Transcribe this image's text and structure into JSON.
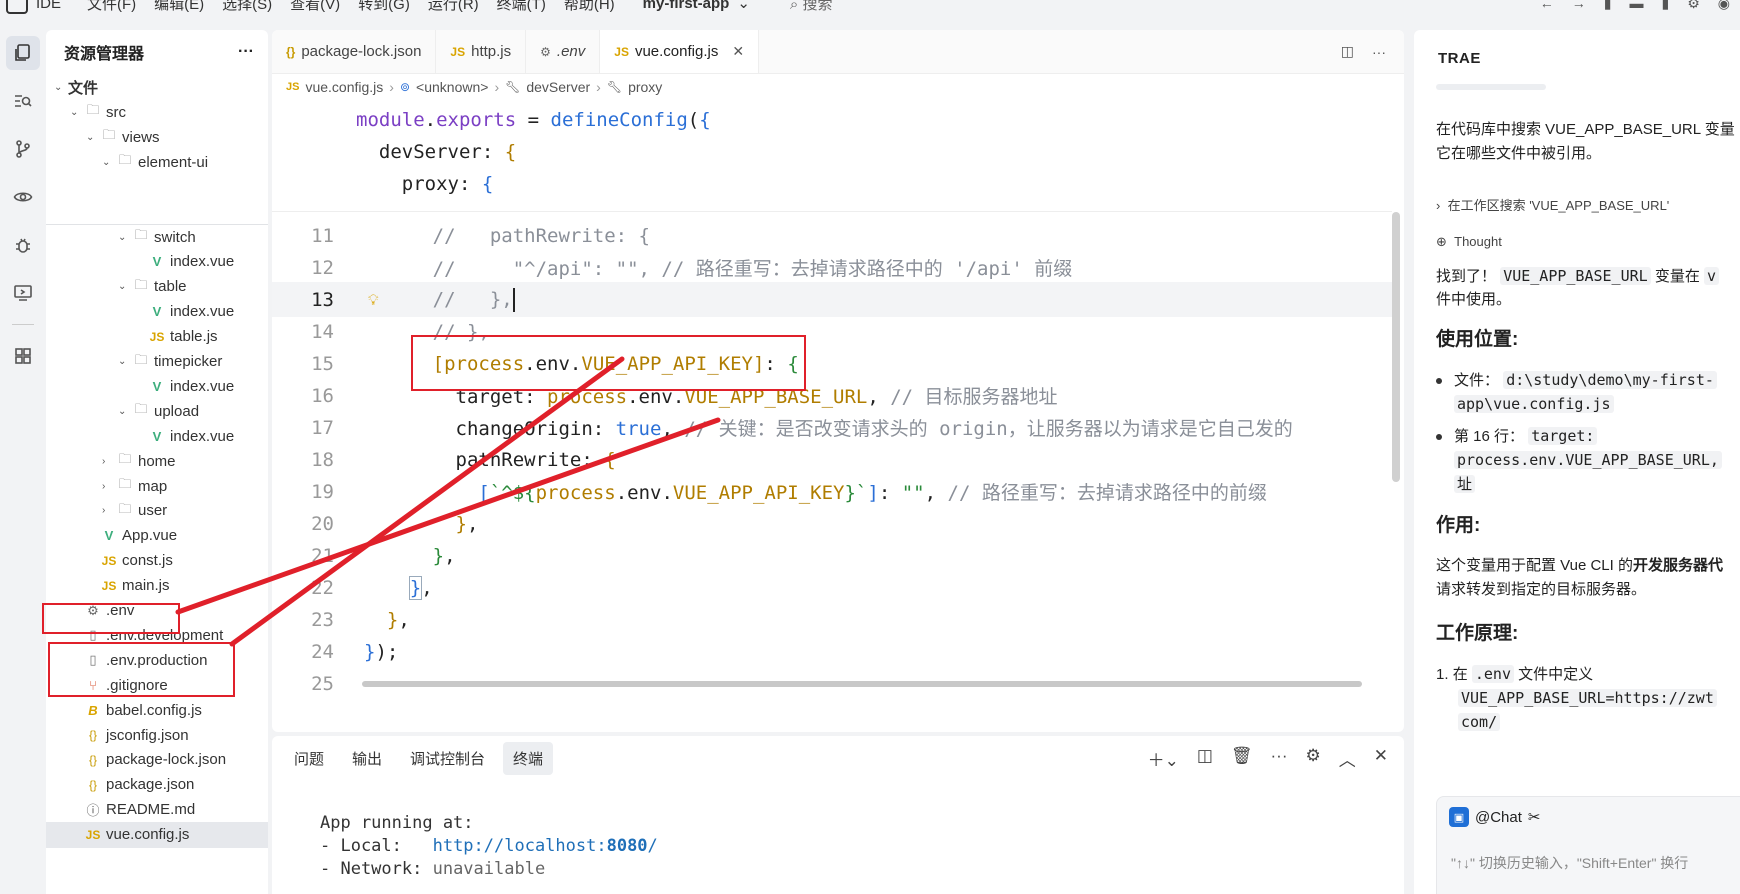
{
  "titlebar": {
    "app": "IDE",
    "menus": [
      "文件(F)",
      "编辑(E)",
      "选择(S)",
      "查看(V)",
      "转到(G)",
      "运行(R)",
      "终端(T)",
      "帮助(H)"
    ],
    "project": "my-first-app",
    "search": "搜索"
  },
  "explorer": {
    "title": "资源管理器",
    "more": "···",
    "items": [
      {
        "label": "文件",
        "depth": 0,
        "type": "root",
        "open": true
      },
      {
        "label": "src",
        "depth": 1,
        "type": "folder",
        "open": true
      },
      {
        "label": "views",
        "depth": 2,
        "type": "folder",
        "open": true
      },
      {
        "label": "element-ui",
        "depth": 3,
        "type": "folder",
        "open": true
      },
      {
        "label": "switch",
        "depth": 4,
        "type": "folder",
        "open": true
      },
      {
        "label": "index.vue",
        "depth": 5,
        "type": "vue"
      },
      {
        "label": "table",
        "depth": 4,
        "type": "folder",
        "open": true
      },
      {
        "label": "index.vue",
        "depth": 5,
        "type": "vue"
      },
      {
        "label": "table.js",
        "depth": 5,
        "type": "js"
      },
      {
        "label": "timepicker",
        "depth": 4,
        "type": "folder",
        "open": true
      },
      {
        "label": "index.vue",
        "depth": 5,
        "type": "vue"
      },
      {
        "label": "upload",
        "depth": 4,
        "type": "folder",
        "open": true
      },
      {
        "label": "index.vue",
        "depth": 5,
        "type": "vue"
      },
      {
        "label": "home",
        "depth": 3,
        "type": "folder",
        "open": false
      },
      {
        "label": "map",
        "depth": 3,
        "type": "folder",
        "open": false
      },
      {
        "label": "user",
        "depth": 3,
        "type": "folder",
        "open": false
      },
      {
        "label": "App.vue",
        "depth": 2,
        "type": "vue"
      },
      {
        "label": "const.js",
        "depth": 2,
        "type": "js"
      },
      {
        "label": "main.js",
        "depth": 2,
        "type": "js"
      },
      {
        "label": ".env",
        "depth": 1,
        "type": "gear"
      },
      {
        "label": ".env.development",
        "depth": 1,
        "type": "file"
      },
      {
        "label": ".env.production",
        "depth": 1,
        "type": "file"
      },
      {
        "label": ".gitignore",
        "depth": 1,
        "type": "git"
      },
      {
        "label": "babel.config.js",
        "depth": 1,
        "type": "babel"
      },
      {
        "label": "jsconfig.json",
        "depth": 1,
        "type": "json"
      },
      {
        "label": "package-lock.json",
        "depth": 1,
        "type": "json"
      },
      {
        "label": "package.json",
        "depth": 1,
        "type": "json"
      },
      {
        "label": "README.md",
        "depth": 1,
        "type": "info"
      },
      {
        "label": "vue.config.js",
        "depth": 1,
        "type": "js",
        "selected": true
      }
    ]
  },
  "editor": {
    "tabs": [
      {
        "label": "package-lock.json",
        "icon": "{}",
        "active": false
      },
      {
        "label": "http.js",
        "icon": "JS",
        "active": false
      },
      {
        "label": ".env",
        "icon": "⚙",
        "active": false,
        "italic": true
      },
      {
        "label": "vue.config.js",
        "icon": "JS",
        "active": true,
        "close": "✕"
      }
    ],
    "breadcrumb": [
      "vue.config.js",
      "<unknown>",
      "devServer",
      "proxy"
    ],
    "sticky": [
      "module.exports = defineConfig({",
      "  devServer: {",
      "    proxy: {"
    ],
    "line_numbers": [
      "11",
      "12",
      "13",
      "14",
      "15",
      "16",
      "17",
      "18",
      "19",
      "20",
      "21",
      "22",
      "23",
      "24",
      "25"
    ],
    "current_line": "13",
    "comment_11": "//   pathRewrite: {",
    "comment_12a": "//     \"^/api\": \"\", ",
    "comment_12b": "// 路径重写：去掉请求路径中的 '/api' 前缀",
    "comment_13": "//   },",
    "comment_14": "// },",
    "line15_key": "[process.env.VUE_APP_API_KEY]",
    "line16_comment": "// 目标服务器地址",
    "line17_comment": "// 关键：是否改变请求头的 origin，让服务器以为请求是它自己发的",
    "line19_comment": "// 路径重写：去掉请求路径中的前缀"
  },
  "panel": {
    "tabs": [
      "问题",
      "输出",
      "调试控制台",
      "终端"
    ],
    "active_tab": "终端",
    "terminal": {
      "line1": "App running at:",
      "local_label": "- Local:   ",
      "local_url_prefix": "http://localhost:",
      "local_port": "8080",
      "local_url_suffix": "/",
      "network_label": "- Network: ",
      "network_value": "unavailable"
    }
  },
  "chat": {
    "title": "TRAE",
    "question_1": "在代码库中搜索 VUE_APP_BASE_URL 变量",
    "question_2": "它在哪些文件中被引用。",
    "step_search": "在工作区搜索 'VUE_APP_BASE_URL'",
    "step_thought": "Thought",
    "found_prefix": "找到了！",
    "found_var": "VUE_APP_BASE_URL",
    "found_mid": "变量在",
    "found_cut": "v",
    "found_line2": "件中使用。",
    "h_usage": "使用位置:",
    "usage_file_label": "文件：",
    "usage_file_path_1": "d:\\study\\demo\\my-first-",
    "usage_file_path_2": "app\\vue.config.js",
    "usage_line_label": "第 16 行：",
    "usage_line_code_1": "target:",
    "usage_line_code_2": "process.env.VUE_APP_BASE_URL,",
    "usage_line_code_3": "址",
    "h_role": "作用:",
    "role_1_prefix": "这个变量用于配置 Vue CLI 的",
    "role_1_bold": "开发服务器代",
    "role_2": "请求转发到指定的目标服务器。",
    "h_principle": "工作原理:",
    "principle_1_num": "1.",
    "principle_1_prefix": "在",
    "principle_1_code": ".env",
    "principle_1_suffix": "文件中定义",
    "principle_1_value_1": "VUE_APP_BASE_URL=https://zwt",
    "principle_1_value_2": "com/",
    "input_mention": "@Chat",
    "input_placeholder": "\"↑↓\" 切换历史输入，\"Shift+Enter\" 换行"
  },
  "colors": {
    "annotation_red": "#e0202a",
    "accent_blue": "#1f6fd6"
  }
}
